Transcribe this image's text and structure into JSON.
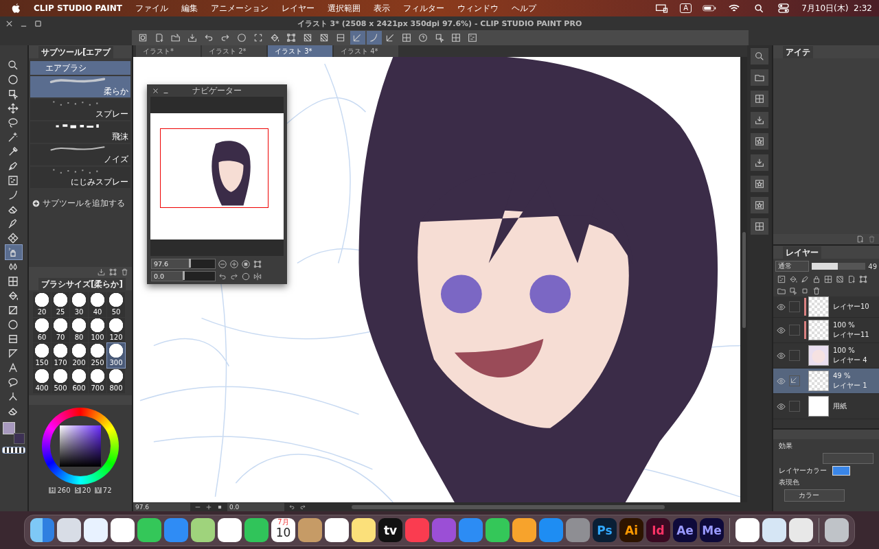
{
  "menubar": {
    "app": "CLIP STUDIO PAINT",
    "menus": [
      "ファイル",
      "編集",
      "アニメーション",
      "レイヤー",
      "選択範囲",
      "表示",
      "フィルター",
      "ウィンドウ",
      "ヘルプ"
    ],
    "input_mode": "A",
    "clock": "7月10日(木)  2:32"
  },
  "window": {
    "title": "イラスト 3* (2508 x 2421px 350dpi 97.6%)  - CLIP STUDIO PAINT PRO"
  },
  "toolbar": [
    {
      "kind": "cloud",
      "selected": false
    },
    {
      "kind": "new",
      "selected": false
    },
    {
      "kind": "open",
      "selected": false
    },
    {
      "kind": "save",
      "selected": false
    },
    {
      "kind": "undo",
      "selected": false
    },
    {
      "kind": "redo",
      "selected": false
    },
    {
      "kind": "rotate",
      "selected": false
    },
    {
      "kind": "deselect",
      "selected": false
    },
    {
      "kind": "fill",
      "selected": false
    },
    {
      "kind": "transform",
      "selected": false
    },
    {
      "kind": "hatch",
      "selected": false
    },
    {
      "kind": "hatch",
      "selected": false
    },
    {
      "kind": "frame",
      "selected": false
    },
    {
      "kind": "ruler",
      "selected": true
    },
    {
      "kind": "curve",
      "selected": true
    },
    {
      "kind": "ruler",
      "selected": false
    },
    {
      "kind": "grid",
      "selected": false
    },
    {
      "kind": "help",
      "selected": false
    },
    {
      "kind": "object",
      "selected": false
    },
    {
      "kind": "grid",
      "selected": false
    },
    {
      "kind": "texture",
      "selected": false
    }
  ],
  "doc_tabs": [
    {
      "label": "イラスト*",
      "selected": false
    },
    {
      "label": "イラスト 2*",
      "selected": false
    },
    {
      "label": "イラスト 3*",
      "selected": true
    },
    {
      "label": "イラスト 4*",
      "selected": false
    }
  ],
  "tools": [
    {
      "kind": "zoom",
      "selected": false
    },
    {
      "kind": "rotate",
      "selected": false
    },
    {
      "kind": "object",
      "selected": false
    },
    {
      "kind": "move",
      "selected": false
    },
    {
      "kind": "lasso",
      "selected": false
    },
    {
      "kind": "wand",
      "selected": false
    },
    {
      "kind": "eyedropper",
      "selected": false
    },
    {
      "kind": "pen",
      "selected": false
    },
    {
      "kind": "texture",
      "selected": false
    },
    {
      "kind": "curve",
      "selected": false
    },
    {
      "kind": "eraser",
      "selected": false
    },
    {
      "kind": "decoration",
      "selected": false
    },
    {
      "kind": "blend",
      "selected": false
    },
    {
      "kind": "airbrush",
      "selected": true
    },
    {
      "kind": "drops",
      "selected": false
    },
    {
      "kind": "grid",
      "selected": false
    },
    {
      "kind": "fill",
      "selected": false
    },
    {
      "kind": "gradient",
      "selected": false
    },
    {
      "kind": "circle",
      "selected": false
    },
    {
      "kind": "frame",
      "selected": false
    },
    {
      "kind": "triangle",
      "selected": false
    },
    {
      "kind": "text",
      "selected": false
    },
    {
      "kind": "balloon",
      "selected": false
    },
    {
      "kind": "vector",
      "selected": false
    },
    {
      "kind": "eraser",
      "selected": false
    }
  ],
  "sub_tool": {
    "tab": "サブツール[エアブ",
    "group": "エアブラシ",
    "items": [
      {
        "label": "柔らか",
        "kind": "soft",
        "selected": true
      },
      {
        "label": "スプレー",
        "kind": "spray",
        "selected": false
      },
      {
        "label": "飛沫",
        "kind": "splash",
        "selected": false
      },
      {
        "label": "ノイズ",
        "kind": "noise",
        "selected": false
      },
      {
        "label": "にじみスプレー",
        "kind": "bleed",
        "selected": false
      }
    ],
    "add": "サブツールを追加する"
  },
  "brush_size": {
    "title": "ブラシサイズ[柔らか]",
    "sizes": [
      {
        "label": "20",
        "selected": false
      },
      {
        "label": "25",
        "selected": false
      },
      {
        "label": "30",
        "selected": false
      },
      {
        "label": "40",
        "selected": false
      },
      {
        "label": "50",
        "selected": false
      },
      {
        "label": "60",
        "selected": false
      },
      {
        "label": "70",
        "selected": false
      },
      {
        "label": "80",
        "selected": false
      },
      {
        "label": "100",
        "selected": false
      },
      {
        "label": "120",
        "selected": false
      },
      {
        "label": "150",
        "selected": false
      },
      {
        "label": "170",
        "selected": false
      },
      {
        "label": "200",
        "selected": false
      },
      {
        "label": "250",
        "selected": false
      },
      {
        "label": "300",
        "selected": true
      },
      {
        "label": "400",
        "selected": false
      },
      {
        "label": "500",
        "selected": false
      },
      {
        "label": "600",
        "selected": false
      },
      {
        "label": "700",
        "selected": false
      },
      {
        "label": "800",
        "selected": false
      }
    ]
  },
  "color": {
    "hsv": [
      {
        "label": "H",
        "value": "260"
      },
      {
        "label": "S",
        "value": "20"
      },
      {
        "label": "V",
        "value": "72"
      }
    ]
  },
  "navigator": {
    "title": "ナビゲーター",
    "zoom": {
      "value": "97.6",
      "level": 0.6
    },
    "rotation": {
      "value": "0.0",
      "level": 0.5
    }
  },
  "status_bar": {
    "zoom": "97.6",
    "rotation": "0.0"
  },
  "item_panel": {
    "tab": "アイテ"
  },
  "layer_panel": {
    "title": "レイヤー",
    "blend_mode": "通常",
    "opacity": {
      "value": "49",
      "level": 0.49
    },
    "layers": [
      {
        "name": "レイヤー10",
        "visible": true,
        "selected": false,
        "clipped": true,
        "kind": "checker"
      },
      {
        "name": "レイヤー11",
        "opacity": "100 %",
        "visible": true,
        "selected": false,
        "clipped": true,
        "kind": "checker"
      },
      {
        "name": "レイヤー 4",
        "opacity": "100 %",
        "visible": true,
        "selected": false,
        "clipped": false,
        "kind": "character"
      },
      {
        "name": "レイヤー 1",
        "opacity": "49 %",
        "visible": true,
        "selected": true,
        "clipped": false,
        "kind": "checker"
      },
      {
        "name": "用紙",
        "visible": true,
        "selected": false,
        "clipped": false,
        "kind": "white"
      }
    ]
  },
  "properties": {
    "effect": "効果",
    "layer_color": "レイヤーカラー",
    "expression_label": "表現色",
    "expression": "カラー"
  },
  "dock": [
    {
      "kind": "finder"
    },
    {
      "kind": "launchpad"
    },
    {
      "kind": "safari"
    },
    {
      "kind": "chrome"
    },
    {
      "kind": "messages"
    },
    {
      "kind": "mail"
    },
    {
      "kind": "maps"
    },
    {
      "kind": "photos"
    },
    {
      "kind": "facetime"
    },
    {
      "kind": "calendar",
      "month": "7月",
      "label": "10"
    },
    {
      "kind": "contacts"
    },
    {
      "kind": "reminders"
    },
    {
      "kind": "notes"
    },
    {
      "kind": "tv",
      "label": "tv"
    },
    {
      "kind": "music"
    },
    {
      "kind": "podcasts"
    },
    {
      "kind": "keynote"
    },
    {
      "kind": "numbers"
    },
    {
      "kind": "pages"
    },
    {
      "kind": "appstore"
    },
    {
      "kind": "settings"
    },
    {
      "kind": "ps",
      "label": "Ps"
    },
    {
      "kind": "ai",
      "label": "Ai"
    },
    {
      "kind": "id",
      "label": "Id"
    },
    {
      "kind": "ae",
      "label": "Ae"
    },
    {
      "kind": "me",
      "label": "Me"
    },
    {
      "kind": "sep"
    },
    {
      "kind": "clip"
    },
    {
      "kind": "preview"
    },
    {
      "kind": "clip2"
    },
    {
      "kind": "sep"
    },
    {
      "kind": "trash"
    }
  ]
}
